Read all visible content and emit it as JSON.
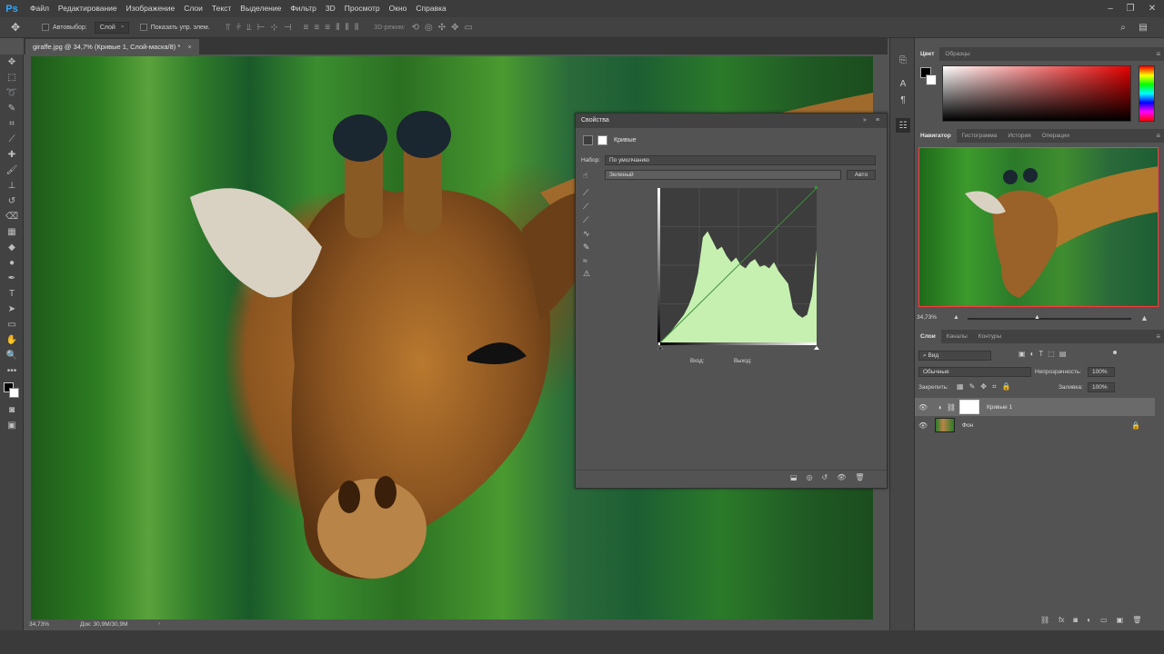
{
  "app": {
    "logo": "Ps"
  },
  "menu": [
    "Файл",
    "Редактирование",
    "Изображение",
    "Слои",
    "Текст",
    "Выделение",
    "Фильтр",
    "3D",
    "Просмотр",
    "Окно",
    "Справка"
  ],
  "options": {
    "autoselect_label": "Автовыбор:",
    "autoselect_value": "Слой",
    "show_controls_label": "Показать упр. элем.",
    "mode_3d_label": "3D-режим:"
  },
  "document": {
    "tab_title": "giraffe.jpg @ 34,7% (Кривые 1, Слой-маска/8) *",
    "close_glyph": "×"
  },
  "status": {
    "zoom": "34,73%",
    "doc_label": "Док: 30,9M/30,9M"
  },
  "properties": {
    "panel_title": "Свойства",
    "adjustment_name": "Кривые",
    "preset_label": "Набор:",
    "preset_value": "По умолчанию",
    "channel_value": "Зеленый",
    "auto_button": "Авто",
    "input_label": "Вход:",
    "output_label": "Выход:"
  },
  "color_panel": {
    "tabs": [
      "Цвет",
      "Образцы"
    ]
  },
  "navigator_panel": {
    "tabs": [
      "Навигатор",
      "Гистограмма",
      "История",
      "Операции"
    ],
    "zoom": "34,73%"
  },
  "layers_panel": {
    "tabs": [
      "Слои",
      "Каналы",
      "Контуры"
    ],
    "kind_filter": "Вид",
    "blend_mode": "Обычные",
    "opacity_label": "Непрозрачность:",
    "opacity_value": "100%",
    "lock_label": "Закрепить:",
    "fill_label": "Заливка:",
    "fill_value": "100%",
    "layers": [
      {
        "name": "Кривые 1"
      },
      {
        "name": "Фон"
      }
    ]
  },
  "colors": {
    "accent": "#3e8e3e",
    "curve_fill": "#c6f0b0",
    "menubar": "#3c3c3c",
    "panel": "#535353"
  },
  "chart_data": {
    "type": "area",
    "channel": "Зеленый",
    "histogram": [
      0,
      3,
      6,
      10,
      14,
      18,
      24,
      32,
      45,
      68,
      72,
      66,
      60,
      62,
      56,
      52,
      55,
      50,
      48,
      52,
      54,
      49,
      50,
      48,
      52,
      46,
      42,
      38,
      22,
      18,
      16,
      18,
      30,
      60
    ]
  }
}
